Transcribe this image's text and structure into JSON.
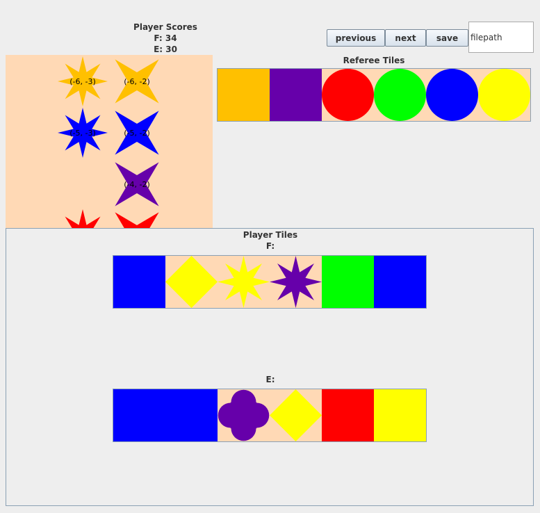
{
  "scores": {
    "title": "Player Scores",
    "lines": [
      "F: 34",
      "E: 30"
    ]
  },
  "controls": {
    "previous": "previous",
    "next": "next",
    "save": "save",
    "filepath": "filepath"
  },
  "board": {
    "tiles": [
      {
        "shape": "star8",
        "color": "#ffc000",
        "label": "(-6, -3)"
      },
      {
        "shape": "star4",
        "color": "#ffc000",
        "label": "(-6, -2)"
      },
      {
        "shape": "star8",
        "color": "#0000ff",
        "label": "(-5, -3)"
      },
      {
        "shape": "star4",
        "color": "#0000ff",
        "label": "(-5, -2)"
      },
      {
        "shape": "star4",
        "color": "#6600aa",
        "label": "(-4, -2)"
      },
      {
        "shape": "star8",
        "color": "#ff0000",
        "label": ""
      },
      {
        "shape": "star4",
        "color": "#ff0000",
        "label": ""
      }
    ]
  },
  "referee": {
    "title": "Referee Tiles",
    "tiles": [
      {
        "shape": "square",
        "color": "#ffc000"
      },
      {
        "shape": "square",
        "color": "#6600aa"
      },
      {
        "shape": "circle",
        "color": "#ff0000"
      },
      {
        "shape": "circle",
        "color": "#00ff00"
      },
      {
        "shape": "circle",
        "color": "#0000ff"
      },
      {
        "shape": "circle",
        "color": "#ffff00"
      }
    ]
  },
  "players": {
    "title": "Player Tiles",
    "list": [
      {
        "name": "F:",
        "tiles": [
          {
            "shape": "square",
            "color": "#0000ff"
          },
          {
            "shape": "diamond",
            "color": "#ffff00"
          },
          {
            "shape": "star8",
            "color": "#ffff00"
          },
          {
            "shape": "star8",
            "color": "#6600aa"
          },
          {
            "shape": "square",
            "color": "#00ff00"
          },
          {
            "shape": "square",
            "color": "#0000ff"
          }
        ]
      },
      {
        "name": "E:",
        "tiles": [
          {
            "shape": "square",
            "color": "#0000ff"
          },
          {
            "shape": "square",
            "color": "#0000ff"
          },
          {
            "shape": "clover",
            "color": "#6600aa"
          },
          {
            "shape": "diamond",
            "color": "#ffff00"
          },
          {
            "shape": "square",
            "color": "#ff0000"
          },
          {
            "shape": "square",
            "color": "#ffff00"
          }
        ]
      }
    ]
  }
}
